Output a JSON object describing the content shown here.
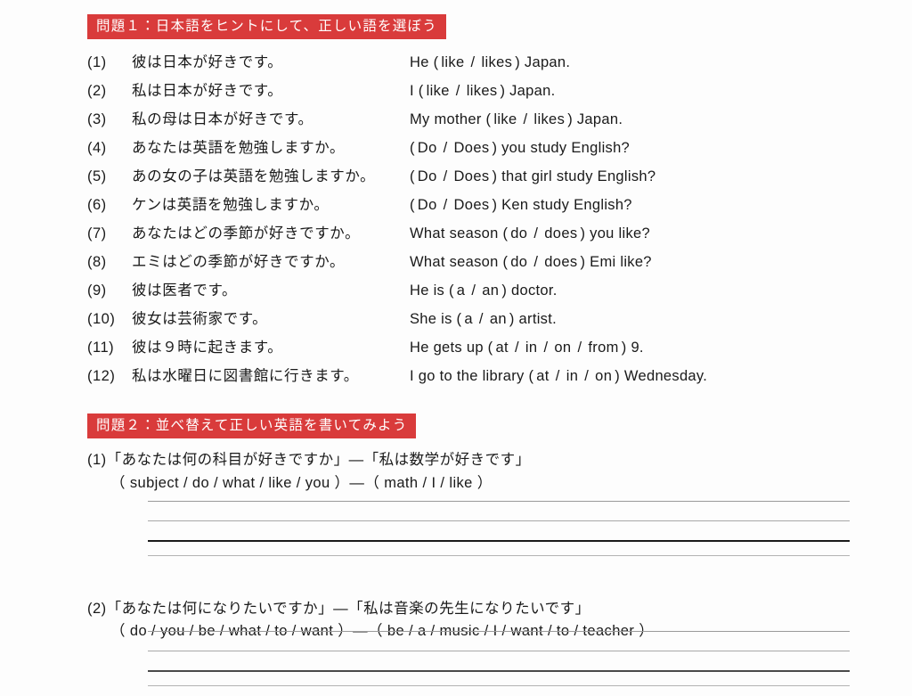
{
  "theme": {
    "banner_bg": "#d93b3b",
    "banner_text": "#ffffff",
    "page_bg": "#fdfdfd",
    "ink": "#1a1a1a",
    "rule_light": "#9a9a9a",
    "rule_dark": "#1a1a1a"
  },
  "section1": {
    "banner": "問題１：日本語をヒントにして、正しい語を選ぼう",
    "questions": [
      {
        "num": "(1)",
        "jp": "彼は日本が好きです。",
        "en_prefix": "He (",
        "options": [
          "like",
          "likes"
        ],
        "en_suffix": ") Japan."
      },
      {
        "num": "(2)",
        "jp": "私は日本が好きです。",
        "en_prefix": "I (",
        "options": [
          "like",
          "likes"
        ],
        "en_suffix": ") Japan."
      },
      {
        "num": "(3)",
        "jp": "私の母は日本が好きです。",
        "en_prefix": "My mother (",
        "options": [
          "like",
          "likes"
        ],
        "en_suffix": ") Japan."
      },
      {
        "num": "(4)",
        "jp": "あなたは英語を勉強しますか。",
        "en_prefix": "(",
        "options": [
          "Do",
          "Does"
        ],
        "en_suffix": ") you study English?"
      },
      {
        "num": "(5)",
        "jp": "あの女の子は英語を勉強しますか。",
        "en_prefix": "(",
        "options": [
          "Do",
          "Does"
        ],
        "en_suffix": ") that girl study English?"
      },
      {
        "num": "(6)",
        "jp": "ケンは英語を勉強しますか。",
        "en_prefix": "(",
        "options": [
          "Do",
          "Does"
        ],
        "en_suffix": ") Ken study English?"
      },
      {
        "num": "(7)",
        "jp": "あなたはどの季節が好きですか。",
        "en_prefix": "What season (",
        "options": [
          "do",
          "does"
        ],
        "en_suffix": ") you like?"
      },
      {
        "num": "(8)",
        "jp": "エミはどの季節が好きですか。",
        "en_prefix": "What season (",
        "options": [
          "do",
          "does"
        ],
        "en_suffix": ") Emi like?"
      },
      {
        "num": "(9)",
        "jp": "彼は医者です。",
        "en_prefix": "He is (",
        "options": [
          "a",
          "an"
        ],
        "en_suffix": ") doctor."
      },
      {
        "num": "(10)",
        "jp": "彼女は芸術家です。",
        "en_prefix": "She is (",
        "options": [
          "a",
          "an"
        ],
        "en_suffix": ") artist."
      },
      {
        "num": "(11)",
        "jp": "彼は９時に起きます。",
        "en_prefix": "He gets up (",
        "options": [
          "at",
          "in",
          "on",
          "from"
        ],
        "en_suffix": ") 9."
      },
      {
        "num": "(12)",
        "jp": "私は水曜日に図書館に行きます。",
        "en_prefix": "I go to the library (",
        "options": [
          "at",
          "in",
          "on"
        ],
        "en_suffix": ") Wednesday."
      }
    ]
  },
  "section2": {
    "banner": "問題２：並べ替えて正しい英語を書いてみよう",
    "questions": [
      {
        "num": "(1)",
        "jp": "「あなたは何の科目が好きですか」—「私は数学が好きです」",
        "words": "（ subject / do / what / like / you ）—（ math / I / like ）"
      },
      {
        "num": "(2)",
        "jp": "「あなたは何になりたいですか」—「私は音楽の先生になりたいです」",
        "words": "（ do / you / be / what / to / want ）—（ be / a / music / I / want / to / teacher ）"
      }
    ]
  }
}
